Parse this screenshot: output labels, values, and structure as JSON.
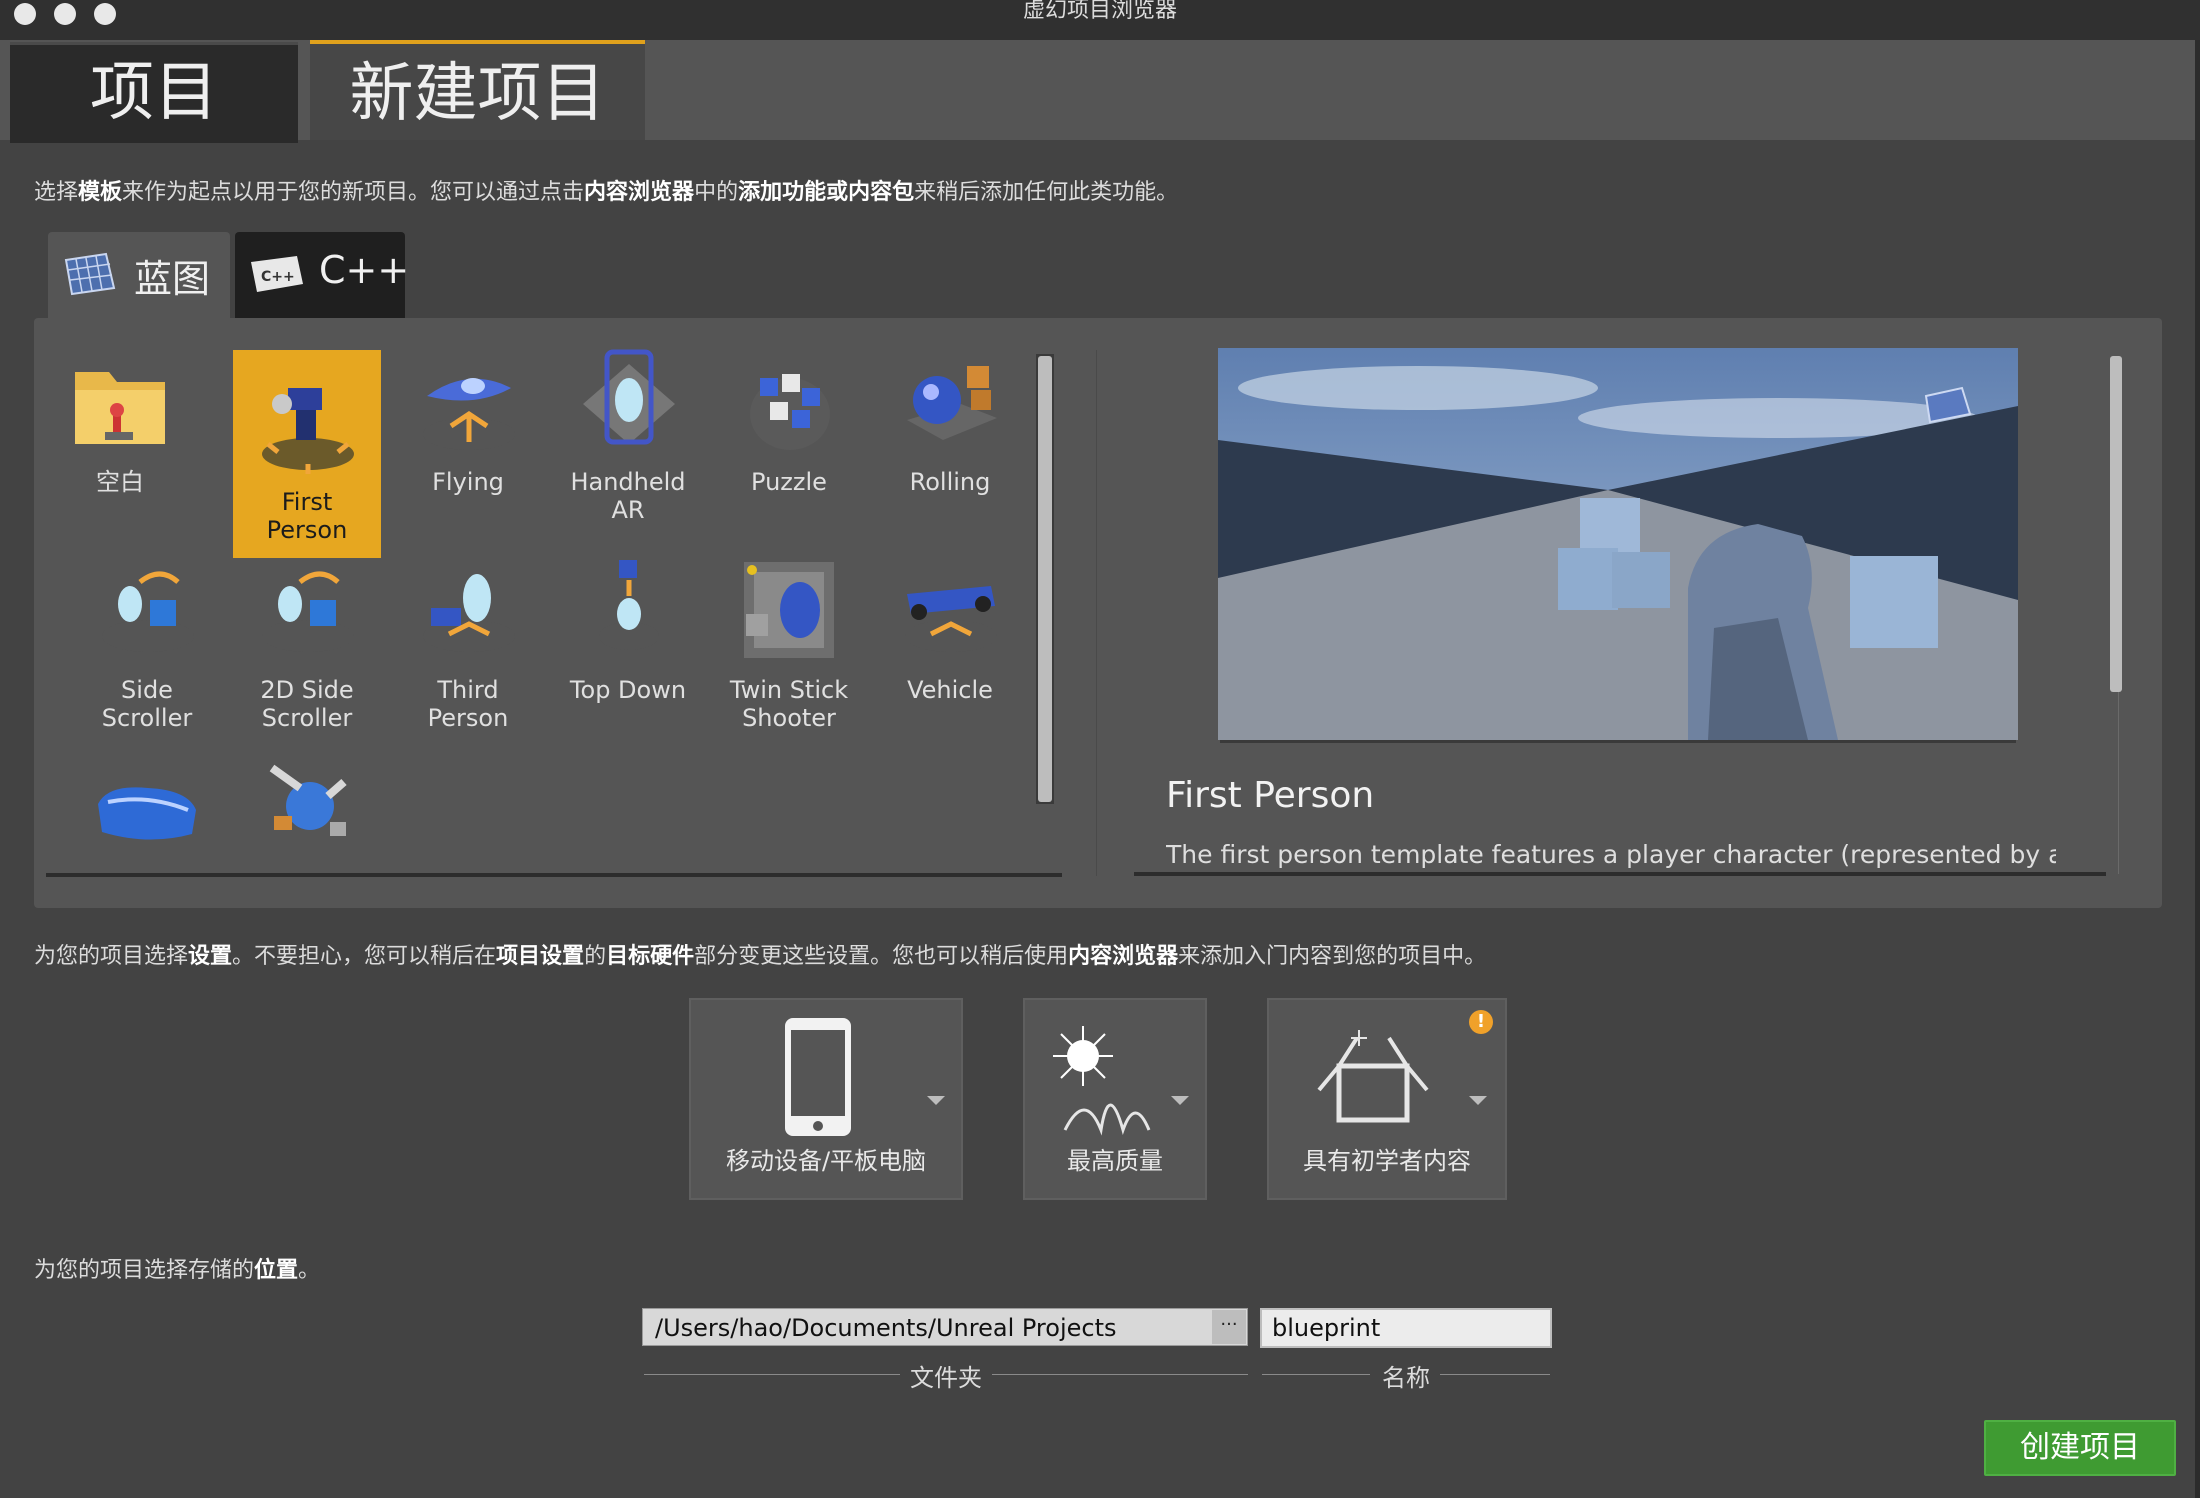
{
  "window": {
    "title": "虚幻项目浏览器"
  },
  "tabs": [
    {
      "label": "项目"
    },
    {
      "label": "新建项目"
    }
  ],
  "intro": {
    "t1": "选择",
    "b1": "模板",
    "t2": "来作为起点以用于您的新项目。您可以通过点击",
    "b2": "内容浏览器",
    "t3": "中的",
    "b3": "添加功能或内容包",
    "t4": "来稍后添加任何此类功能。"
  },
  "language_tabs": [
    {
      "label": "蓝图",
      "icon": "blueprint-icon"
    },
    {
      "label": "C++",
      "icon": "cpp-icon"
    }
  ],
  "templates": [
    {
      "label": "空白",
      "icon": "folder-icon"
    },
    {
      "label": "First\nPerson",
      "icon": "first-person-icon",
      "selected": true
    },
    {
      "label": "Flying",
      "icon": "spaceship-icon"
    },
    {
      "label": "Handheld\nAR",
      "icon": "phone-ar-icon"
    },
    {
      "label": "Puzzle",
      "icon": "puzzle-icon"
    },
    {
      "label": "Rolling",
      "icon": "rolling-ball-icon"
    },
    {
      "label": "Side\nScroller",
      "icon": "side-scroller-icon"
    },
    {
      "label": "2D Side\nScroller",
      "icon": "side-scroller-2d-icon"
    },
    {
      "label": "Third\nPerson",
      "icon": "third-person-icon"
    },
    {
      "label": "Top Down",
      "icon": "top-down-icon"
    },
    {
      "label": "Twin Stick\nShooter",
      "icon": "twin-stick-icon"
    },
    {
      "label": "Vehicle",
      "icon": "vehicle-icon"
    },
    {
      "label": "",
      "icon": "vr-headset-icon"
    },
    {
      "label": "",
      "icon": "robot-arm-icon"
    }
  ],
  "description": {
    "title": "First Person",
    "text": "The first person template features a player character (represented by a pair of arms)"
  },
  "settings_intro": {
    "t1": "为您的项目选择",
    "b1": "设置",
    "t2": "。不要担心，您可以稍后在",
    "b2": "项目设置",
    "t3": "的",
    "b3": "目标硬件",
    "t4": "部分变更这些设置。您也可以稍后使用",
    "b4": "内容浏览器",
    "t5": "来添加入门内容到您的项目中。"
  },
  "settings": [
    {
      "label": "移动设备/平板电脑",
      "icon": "mobile-device-icon"
    },
    {
      "label": "最高质量",
      "icon": "quality-icon"
    },
    {
      "label": "具有初学者内容",
      "icon": "starter-content-icon",
      "warning": true
    }
  ],
  "location": {
    "t1": "为您的项目选择存储的",
    "b1": "位置",
    "t2": "。",
    "folder_path": "/Users/hao/Documents/Unreal Projects",
    "browse_label": "···",
    "folder_caption": "文件夹",
    "name_value": "blueprint",
    "name_caption": "名称"
  },
  "create_button": "创建项目",
  "colors": {
    "accent": "#e6a720",
    "create": "#3f9b32",
    "background": "#434343"
  }
}
